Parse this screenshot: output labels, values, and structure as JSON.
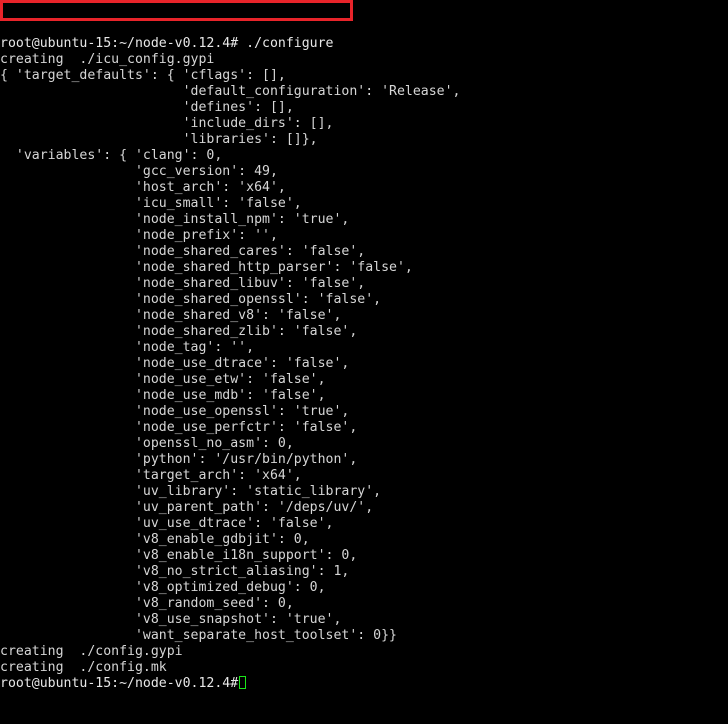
{
  "terminal": {
    "background_color": "#000000",
    "text_color": "#d6d6d6",
    "cursor_color": "#19e819",
    "annotation_color": "#e8242a",
    "prompt": "root@ubuntu-15:~/node-v0.12.4#",
    "command": "./configure",
    "top_line": "root@ubuntu-15:~/node-v0.12.4# ./configure",
    "bottom_prompt": "root@ubuntu-15:~/node-v0.12.4#",
    "lines": [
      "creating  ./icu_config.gypi",
      "{ 'target_defaults': { 'cflags': [],",
      "                       'default_configuration': 'Release',",
      "                       'defines': [],",
      "                       'include_dirs': [],",
      "                       'libraries': []},",
      "  'variables': { 'clang': 0,",
      "                 'gcc_version': 49,",
      "                 'host_arch': 'x64',",
      "                 'icu_small': 'false',",
      "                 'node_install_npm': 'true',",
      "                 'node_prefix': '',",
      "                 'node_shared_cares': 'false',",
      "                 'node_shared_http_parser': 'false',",
      "                 'node_shared_libuv': 'false',",
      "                 'node_shared_openssl': 'false',",
      "                 'node_shared_v8': 'false',",
      "                 'node_shared_zlib': 'false',",
      "                 'node_tag': '',",
      "                 'node_use_dtrace': 'false',",
      "                 'node_use_etw': 'false',",
      "                 'node_use_mdb': 'false',",
      "                 'node_use_openssl': 'true',",
      "                 'node_use_perfctr': 'false',",
      "                 'openssl_no_asm': 0,",
      "                 'python': '/usr/bin/python',",
      "                 'target_arch': 'x64',",
      "                 'uv_library': 'static_library',",
      "                 'uv_parent_path': '/deps/uv/',",
      "                 'uv_use_dtrace': 'false',",
      "                 'v8_enable_gdbjit': 0,",
      "                 'v8_enable_i18n_support': 0,",
      "                 'v8_no_strict_aliasing': 1,",
      "                 'v8_optimized_debug': 0,",
      "                 'v8_random_seed': 0,",
      "                 'v8_use_snapshot': 'true',",
      "                 'want_separate_host_toolset': 0}}",
      "creating  ./config.gypi",
      "creating  ./config.mk"
    ]
  }
}
